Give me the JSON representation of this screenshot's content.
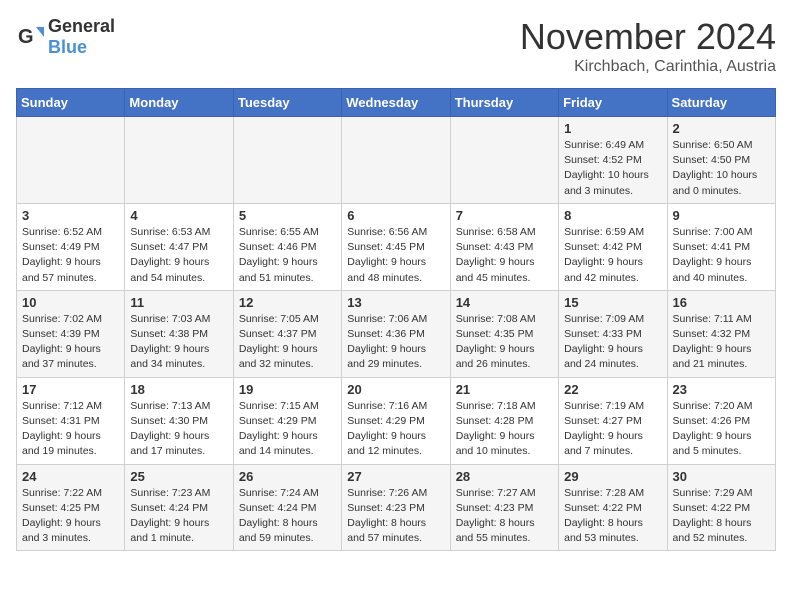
{
  "logo": {
    "general": "General",
    "blue": "Blue"
  },
  "title": "November 2024",
  "location": "Kirchbach, Carinthia, Austria",
  "days_of_week": [
    "Sunday",
    "Monday",
    "Tuesday",
    "Wednesday",
    "Thursday",
    "Friday",
    "Saturday"
  ],
  "weeks": [
    [
      {
        "day": "",
        "info": ""
      },
      {
        "day": "",
        "info": ""
      },
      {
        "day": "",
        "info": ""
      },
      {
        "day": "",
        "info": ""
      },
      {
        "day": "",
        "info": ""
      },
      {
        "day": "1",
        "info": "Sunrise: 6:49 AM\nSunset: 4:52 PM\nDaylight: 10 hours\nand 3 minutes."
      },
      {
        "day": "2",
        "info": "Sunrise: 6:50 AM\nSunset: 4:50 PM\nDaylight: 10 hours\nand 0 minutes."
      }
    ],
    [
      {
        "day": "3",
        "info": "Sunrise: 6:52 AM\nSunset: 4:49 PM\nDaylight: 9 hours\nand 57 minutes."
      },
      {
        "day": "4",
        "info": "Sunrise: 6:53 AM\nSunset: 4:47 PM\nDaylight: 9 hours\nand 54 minutes."
      },
      {
        "day": "5",
        "info": "Sunrise: 6:55 AM\nSunset: 4:46 PM\nDaylight: 9 hours\nand 51 minutes."
      },
      {
        "day": "6",
        "info": "Sunrise: 6:56 AM\nSunset: 4:45 PM\nDaylight: 9 hours\nand 48 minutes."
      },
      {
        "day": "7",
        "info": "Sunrise: 6:58 AM\nSunset: 4:43 PM\nDaylight: 9 hours\nand 45 minutes."
      },
      {
        "day": "8",
        "info": "Sunrise: 6:59 AM\nSunset: 4:42 PM\nDaylight: 9 hours\nand 42 minutes."
      },
      {
        "day": "9",
        "info": "Sunrise: 7:00 AM\nSunset: 4:41 PM\nDaylight: 9 hours\nand 40 minutes."
      }
    ],
    [
      {
        "day": "10",
        "info": "Sunrise: 7:02 AM\nSunset: 4:39 PM\nDaylight: 9 hours\nand 37 minutes."
      },
      {
        "day": "11",
        "info": "Sunrise: 7:03 AM\nSunset: 4:38 PM\nDaylight: 9 hours\nand 34 minutes."
      },
      {
        "day": "12",
        "info": "Sunrise: 7:05 AM\nSunset: 4:37 PM\nDaylight: 9 hours\nand 32 minutes."
      },
      {
        "day": "13",
        "info": "Sunrise: 7:06 AM\nSunset: 4:36 PM\nDaylight: 9 hours\nand 29 minutes."
      },
      {
        "day": "14",
        "info": "Sunrise: 7:08 AM\nSunset: 4:35 PM\nDaylight: 9 hours\nand 26 minutes."
      },
      {
        "day": "15",
        "info": "Sunrise: 7:09 AM\nSunset: 4:33 PM\nDaylight: 9 hours\nand 24 minutes."
      },
      {
        "day": "16",
        "info": "Sunrise: 7:11 AM\nSunset: 4:32 PM\nDaylight: 9 hours\nand 21 minutes."
      }
    ],
    [
      {
        "day": "17",
        "info": "Sunrise: 7:12 AM\nSunset: 4:31 PM\nDaylight: 9 hours\nand 19 minutes."
      },
      {
        "day": "18",
        "info": "Sunrise: 7:13 AM\nSunset: 4:30 PM\nDaylight: 9 hours\nand 17 minutes."
      },
      {
        "day": "19",
        "info": "Sunrise: 7:15 AM\nSunset: 4:29 PM\nDaylight: 9 hours\nand 14 minutes."
      },
      {
        "day": "20",
        "info": "Sunrise: 7:16 AM\nSunset: 4:29 PM\nDaylight: 9 hours\nand 12 minutes."
      },
      {
        "day": "21",
        "info": "Sunrise: 7:18 AM\nSunset: 4:28 PM\nDaylight: 9 hours\nand 10 minutes."
      },
      {
        "day": "22",
        "info": "Sunrise: 7:19 AM\nSunset: 4:27 PM\nDaylight: 9 hours\nand 7 minutes."
      },
      {
        "day": "23",
        "info": "Sunrise: 7:20 AM\nSunset: 4:26 PM\nDaylight: 9 hours\nand 5 minutes."
      }
    ],
    [
      {
        "day": "24",
        "info": "Sunrise: 7:22 AM\nSunset: 4:25 PM\nDaylight: 9 hours\nand 3 minutes."
      },
      {
        "day": "25",
        "info": "Sunrise: 7:23 AM\nSunset: 4:24 PM\nDaylight: 9 hours\nand 1 minute."
      },
      {
        "day": "26",
        "info": "Sunrise: 7:24 AM\nSunset: 4:24 PM\nDaylight: 8 hours\nand 59 minutes."
      },
      {
        "day": "27",
        "info": "Sunrise: 7:26 AM\nSunset: 4:23 PM\nDaylight: 8 hours\nand 57 minutes."
      },
      {
        "day": "28",
        "info": "Sunrise: 7:27 AM\nSunset: 4:23 PM\nDaylight: 8 hours\nand 55 minutes."
      },
      {
        "day": "29",
        "info": "Sunrise: 7:28 AM\nSunset: 4:22 PM\nDaylight: 8 hours\nand 53 minutes."
      },
      {
        "day": "30",
        "info": "Sunrise: 7:29 AM\nSunset: 4:22 PM\nDaylight: 8 hours\nand 52 minutes."
      }
    ]
  ]
}
